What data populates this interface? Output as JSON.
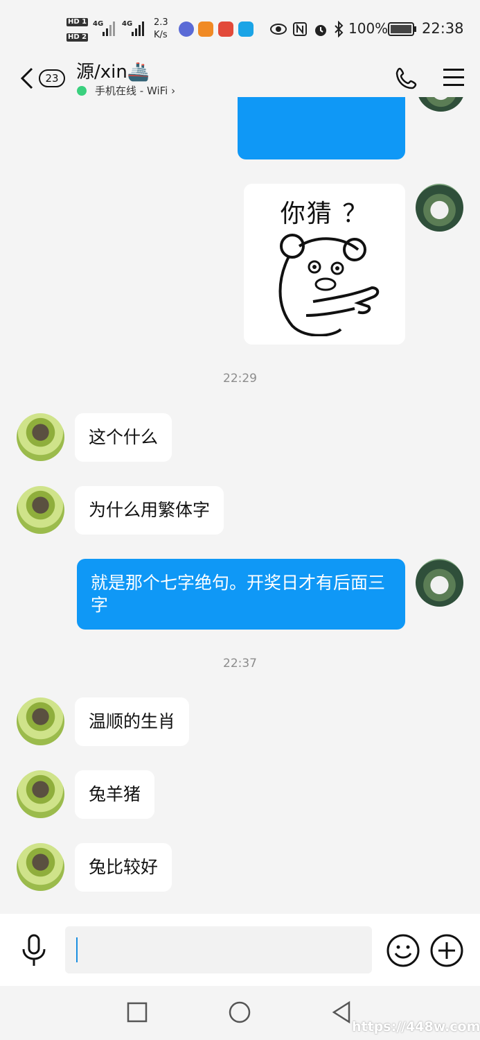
{
  "status_bar": {
    "hd1": "HD 1",
    "hd2": "HD 2",
    "net1": "4G",
    "net2": "4G",
    "speed_value": "2.3",
    "speed_unit": "K/s",
    "battery": "100%",
    "time": "22:38"
  },
  "header": {
    "back_count": "23",
    "title": "源/xin🚢",
    "subtitle": "手机在线 - WiFi",
    "online_color": "#3ad07e"
  },
  "messages": [
    {
      "side": "right",
      "type": "text",
      "text": ""
    },
    {
      "side": "right",
      "type": "sticker",
      "text": "你猜 ？"
    },
    {
      "type": "time",
      "text": "22:29"
    },
    {
      "side": "left",
      "type": "text",
      "text": "这个什么"
    },
    {
      "side": "left",
      "type": "text",
      "text": "为什么用繁体字"
    },
    {
      "side": "right",
      "type": "text",
      "text": "就是那个七字绝句。开奖日才有后面三字"
    },
    {
      "type": "time",
      "text": "22:37"
    },
    {
      "side": "left",
      "type": "text",
      "text": "温顺的生肖"
    },
    {
      "side": "left",
      "type": "text",
      "text": "兔羊猪"
    },
    {
      "side": "left",
      "type": "text",
      "text": "兔比较好"
    }
  ],
  "input": {
    "value": "",
    "mic_icon": "microphone-icon",
    "emoji_icon": "smiley-icon",
    "plus_icon": "plus-circle-icon"
  },
  "colors": {
    "bubble_right": "#0f98f6",
    "bubble_left": "#ffffff",
    "background": "#f4f4f4"
  },
  "watermark": "https://448w.com"
}
